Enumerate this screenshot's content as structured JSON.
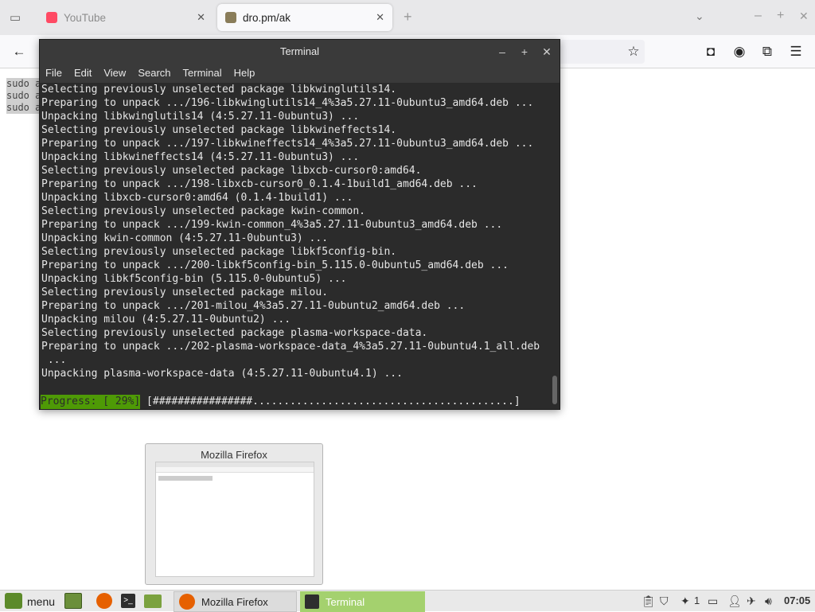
{
  "browser": {
    "tabs": [
      {
        "title": "YouTube",
        "active": false
      },
      {
        "title": "dro.pm/ak",
        "active": true
      }
    ],
    "new_tab_symbol": "+",
    "page_text": [
      "sudo a",
      "sudo a",
      "sudo a"
    ]
  },
  "terminal": {
    "title": "Terminal",
    "menu": [
      "File",
      "Edit",
      "View",
      "Search",
      "Terminal",
      "Help"
    ],
    "lines": [
      "Selecting previously unselected package libkwinglutils14.",
      "Preparing to unpack .../196-libkwinglutils14_4%3a5.27.11-0ubuntu3_amd64.deb ...",
      "Unpacking libkwinglutils14 (4:5.27.11-0ubuntu3) ...",
      "Selecting previously unselected package libkwineffects14.",
      "Preparing to unpack .../197-libkwineffects14_4%3a5.27.11-0ubuntu3_amd64.deb ...",
      "Unpacking libkwineffects14 (4:5.27.11-0ubuntu3) ...",
      "Selecting previously unselected package libxcb-cursor0:amd64.",
      "Preparing to unpack .../198-libxcb-cursor0_0.1.4-1build1_amd64.deb ...",
      "Unpacking libxcb-cursor0:amd64 (0.1.4-1build1) ...",
      "Selecting previously unselected package kwin-common.",
      "Preparing to unpack .../199-kwin-common_4%3a5.27.11-0ubuntu3_amd64.deb ...",
      "Unpacking kwin-common (4:5.27.11-0ubuntu3) ...",
      "Selecting previously unselected package libkf5config-bin.",
      "Preparing to unpack .../200-libkf5config-bin_5.115.0-0ubuntu5_amd64.deb ...",
      "Unpacking libkf5config-bin (5.115.0-0ubuntu5) ...",
      "Selecting previously unselected package milou.",
      "Preparing to unpack .../201-milou_4%3a5.27.11-0ubuntu2_amd64.deb ...",
      "Unpacking milou (4:5.27.11-0ubuntu2) ...",
      "Selecting previously unselected package plasma-workspace-data.",
      "Preparing to unpack .../202-plasma-workspace-data_4%3a5.27.11-0ubuntu4.1_all.deb",
      " ...",
      "Unpacking plasma-workspace-data (4:5.27.11-0ubuntu4.1) ..."
    ],
    "progress_label": "Progress: [ 29%]",
    "progress_bar": " [################..........................................]",
    "progress_percent": 29
  },
  "preview": {
    "title": "Mozilla Firefox"
  },
  "taskbar": {
    "menu_label": "menu",
    "firefox_label": "Mozilla Firefox",
    "terminal_label": "Terminal",
    "notification_count": "1",
    "clock": "07:05"
  },
  "colors": {
    "terminal_bg": "#2b2b2b",
    "progress_green": "#4e9a06",
    "taskbar_active": "#a4d16e"
  }
}
